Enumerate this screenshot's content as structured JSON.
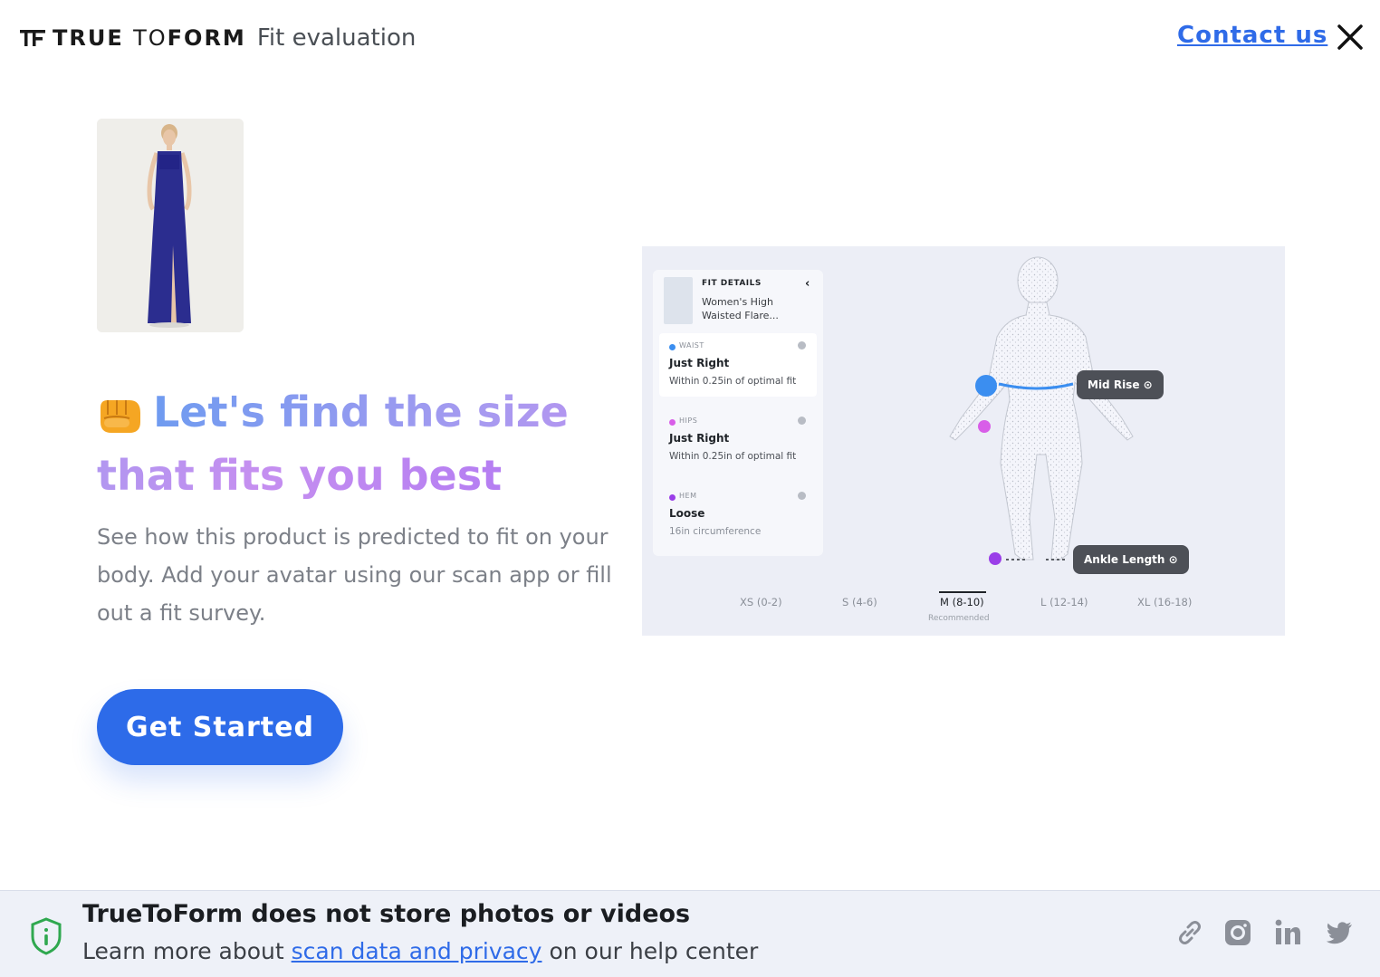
{
  "header": {
    "logo_prefix": "TRUE",
    "logo_middle": "TO",
    "logo_suffix": "FORM",
    "subtitle": "Fit evaluation",
    "contact_label": "Contact us"
  },
  "hero": {
    "headline_emoji": "fist-bump-emoji",
    "headline": "Let's find the size that fits you best",
    "description": "See how this product is predicted to fit on your body. Add your avatar using our scan app or fill out a fit survey.",
    "cta_label": "Get Started"
  },
  "fit_preview": {
    "header_title": "FIT DETAILS",
    "product_name": "Women's High Waisted Flare...",
    "items": [
      {
        "area": "WAIST",
        "status": "Just Right",
        "note": "Within 0.25in of optimal fit",
        "color": "#3b8ef0"
      },
      {
        "area": "HIPS",
        "status": "Just Right",
        "note": "Within 0.25in of optimal fit",
        "color": "#d85ee8"
      },
      {
        "area": "HEM",
        "status": "Loose",
        "note": "16in circumference",
        "color": "#9a3ee8"
      }
    ],
    "pills": [
      "Mid Rise",
      "Ankle Length"
    ],
    "sizes": [
      "XS (0-2)",
      "S (4-6)",
      "M (8-10)",
      "L (12-14)",
      "XL (16-18)"
    ],
    "selected_size": "M (8-10)",
    "recommended_label": "Recommended"
  },
  "footer": {
    "title": "TrueToForm does not store photos or videos",
    "line_prefix": "Learn more about",
    "link_label": "scan data and privacy",
    "line_suffix": "on our help center",
    "social_icons": [
      "link-icon",
      "instagram-icon",
      "linkedin-icon",
      "twitter-icon"
    ]
  },
  "colors": {
    "accent": "#2d6be9",
    "link": "#2f6be8",
    "gradient_start": "#6f9bf0",
    "gradient_end": "#b57ef2",
    "footer_bg": "#eef1f8"
  }
}
